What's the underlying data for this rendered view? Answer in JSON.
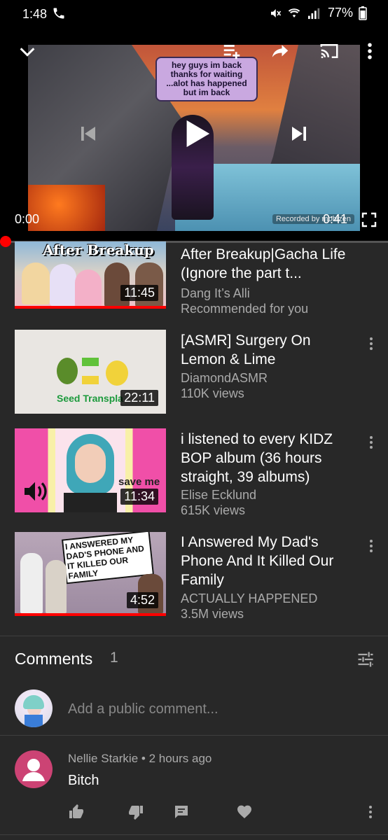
{
  "status_bar": {
    "time": "1:48",
    "battery": "77%"
  },
  "player": {
    "bubble_text": "hey guys im back thanks for waiting ...alot has happened but im back",
    "watermark": "Recorded by mobizen",
    "time_current": "0:00",
    "time_total": "0:41",
    "progress": 0.0
  },
  "videos": [
    {
      "title": "After Breakup|Gacha Life (Ignore the part t...",
      "channel": "Dang It’s Alli",
      "meta": "Recommended for you",
      "duration": "11:45",
      "thumb_text": "After Breakup"
    },
    {
      "title": "[ASMR] Surgery On Lemon & Lime",
      "channel": "DiamondASMR",
      "meta": "110K views",
      "duration": "22:11",
      "thumb_text": "Seed Transpla"
    },
    {
      "title": "i listened to every KIDZ BOP album (36 hours straight, 39 albums)",
      "channel": "Elise Ecklund",
      "meta": "615K views",
      "duration": "11:34",
      "thumb_text": "save me"
    },
    {
      "title": "I Answered My Dad's Phone And It Killed Our Family",
      "channel": "ACTUALLY HAPPENED",
      "meta": "3.5M views",
      "duration": "4:52",
      "thumb_text": "I ANSWERED MY DAD'S PHONE AND IT KILLED OUR FAMILY"
    }
  ],
  "comments": {
    "title": "Comments",
    "count": "1",
    "add_placeholder": "Add a public comment...",
    "items": [
      {
        "author": "Nellie Starkie",
        "time": "2 hours ago",
        "text": "Bitch"
      }
    ]
  },
  "colors": {
    "background": "#282828",
    "accent_red": "#ff0000",
    "meta_gray": "#aaaaaa"
  }
}
